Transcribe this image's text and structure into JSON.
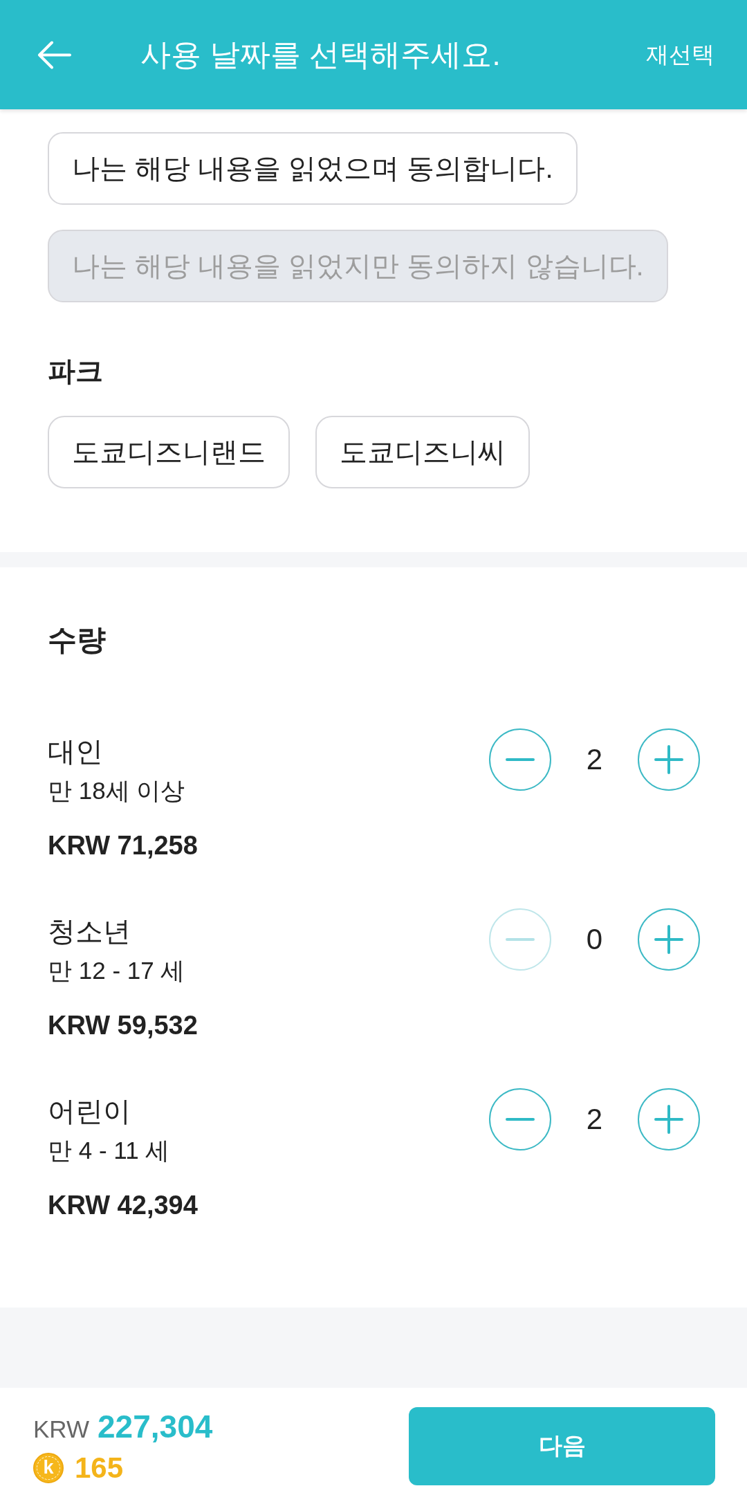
{
  "header": {
    "title": "사용 날짜를 선택해주세요.",
    "action": "재선택"
  },
  "agreement": {
    "options": [
      {
        "label": "나는 해당 내용을 읽었으며 동의합니다.",
        "disabled": false
      },
      {
        "label": "나는 해당 내용을 읽었지만 동의하지 않습니다.",
        "disabled": true
      }
    ]
  },
  "park": {
    "title": "파크",
    "options": [
      {
        "label": "도쿄디즈니랜드",
        "selected": false
      },
      {
        "label": "도쿄디즈니씨",
        "selected": false
      }
    ]
  },
  "quantity": {
    "title": "수량",
    "rows": [
      {
        "name": "대인",
        "age": "만 18세 이상",
        "price": "KRW 71,258",
        "count": "2",
        "decrement_disabled": false
      },
      {
        "name": "청소년",
        "age": "만 12 - 17 세",
        "price": "KRW 59,532",
        "count": "0",
        "decrement_disabled": true
      },
      {
        "name": "어린이",
        "age": "만 4 - 11 세",
        "price": "KRW 42,394",
        "count": "2",
        "decrement_disabled": false
      }
    ]
  },
  "footer": {
    "currency": "KRW",
    "total": "227,304",
    "coin_mark": "k",
    "points": "165",
    "next_button": "다음"
  }
}
